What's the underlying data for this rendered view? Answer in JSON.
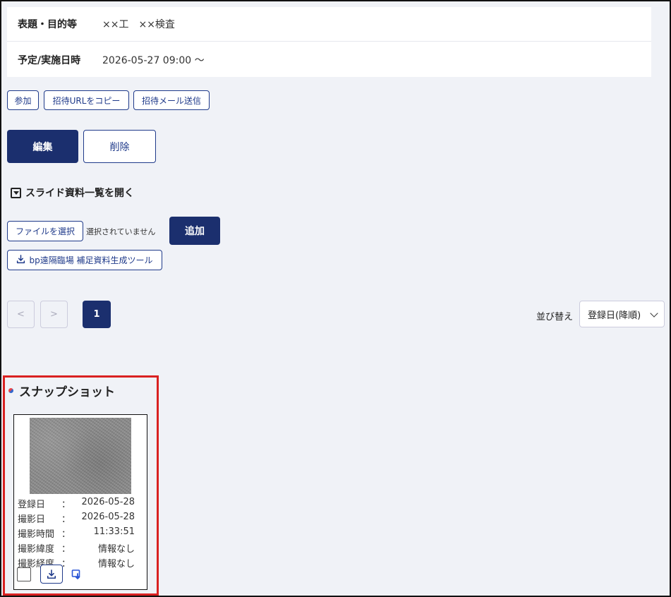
{
  "info": {
    "title_label": "表題・目的等",
    "title_value": "××工　××検査",
    "datetime_label": "予定/実施日時",
    "datetime_value": "2026-05-27 09:00 〜"
  },
  "actions": {
    "join": "参加",
    "copy_url": "招待URLをコピー",
    "send_mail": "招待メール送信",
    "edit": "編集",
    "delete": "削除"
  },
  "slides": {
    "toggle_label": "スライド資料一覧を開く",
    "file_select": "ファイルを選択",
    "file_status": "選択されていません",
    "add": "追加",
    "tool_download": "bp遠隔臨場 補足資料生成ツール"
  },
  "pagination": {
    "prev": "<",
    "next": ">",
    "current": "1"
  },
  "sort": {
    "label": "並び替え",
    "selected": "登録日(降順)"
  },
  "snapshot": {
    "section_title": "スナップショット",
    "items": [
      {
        "rows": [
          {
            "label": "登録日",
            "value": "2026-05-28"
          },
          {
            "label": "撮影日",
            "value": "2026-05-28"
          },
          {
            "label": "撮影時間",
            "value": "11:33:51"
          },
          {
            "label": "撮影緯度",
            "value": "情報なし"
          },
          {
            "label": "撮影経度",
            "value": "情報なし"
          }
        ],
        "colon": "："
      }
    ]
  },
  "colors": {
    "primary": "#1b2f6e",
    "highlight_border": "#d92121",
    "background": "#f0f2f7"
  }
}
